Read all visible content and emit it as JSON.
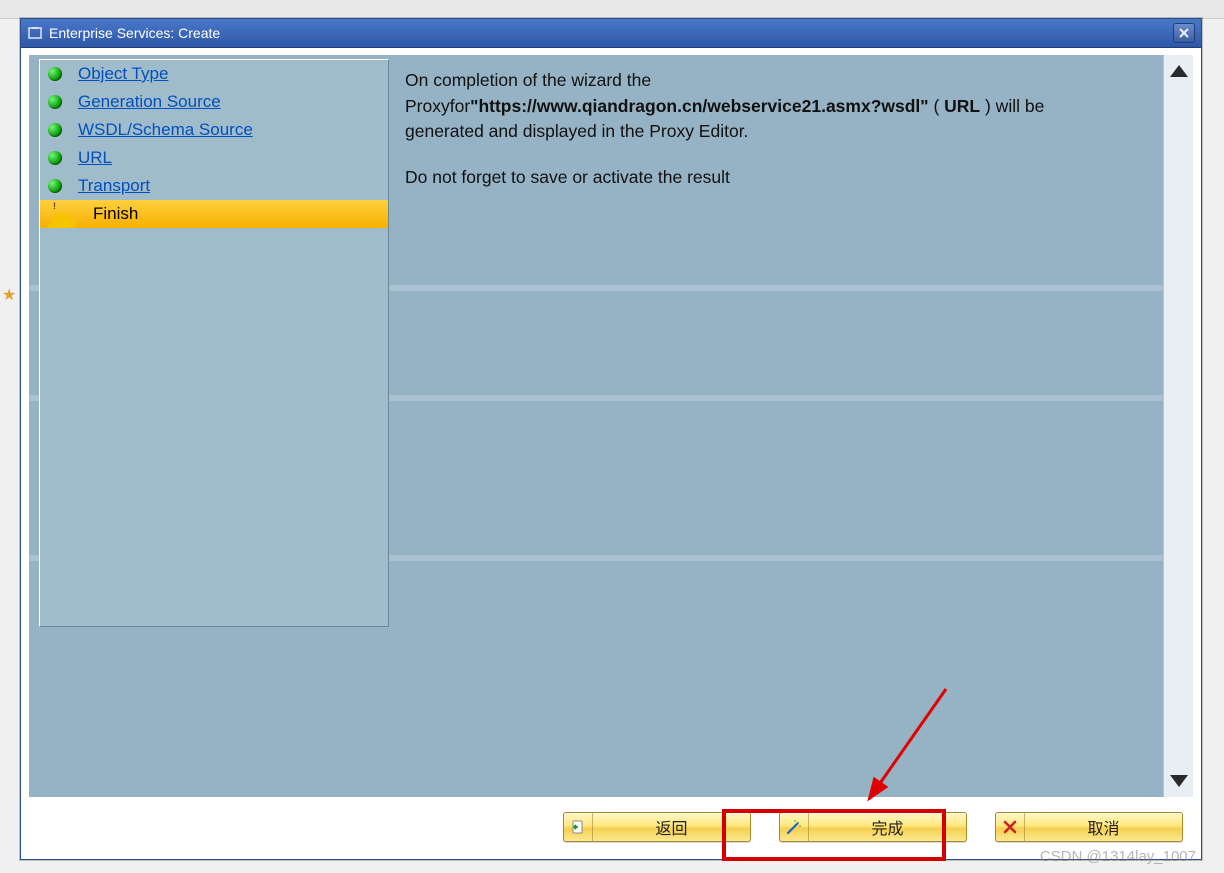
{
  "window": {
    "title": "Enterprise Services: Create"
  },
  "nav": {
    "items": [
      {
        "label": "Object Type",
        "state": "done",
        "link": true
      },
      {
        "label": "Generation Source",
        "state": "done",
        "link": true
      },
      {
        "label": "WSDL/Schema Source",
        "state": "done",
        "link": true
      },
      {
        "label": "URL",
        "state": "done",
        "link": true
      },
      {
        "label": "Transport",
        "state": "done",
        "link": true
      },
      {
        "label": "Finish",
        "state": "current",
        "link": false
      }
    ]
  },
  "content": {
    "line1_a": "On completion of the wizard the",
    "line2_a": "Proxyfor",
    "line2_url": "\"https://www.qiandragon.cn/webservice21.asmx?wsdl\"",
    "line2_b": " ( ",
    "line2_url_label": "URL",
    "line2_c": " ) will be",
    "line3": "generated and displayed in the Proxy Editor.",
    "line5": "Do not forget to save or activate the result"
  },
  "buttons": {
    "back": "返回",
    "finish": "完成",
    "cancel": "取消"
  },
  "watermark": "CSDN @1314lay_1007"
}
